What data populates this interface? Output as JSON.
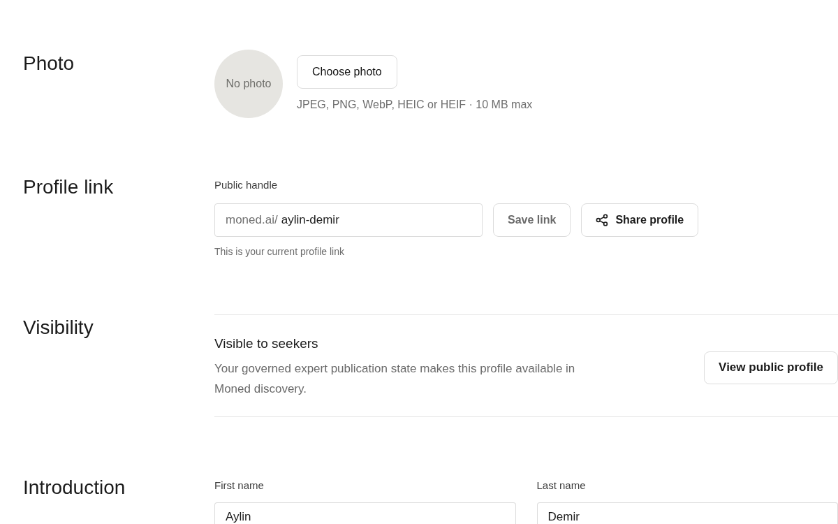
{
  "sections": [
    {
      "kind": "photo",
      "heading": "Photo",
      "avatar": {
        "text": "No photo"
      },
      "button": {
        "label": "Choose photo"
      },
      "hint": "JPEG, PNG, WebP, HEIC or HEIF · 10 MB max"
    },
    {
      "kind": "link",
      "heading": "Profile link",
      "field": {
        "label": "Public handle",
        "prefix": "moned.ai/",
        "value": "aylin-demir"
      },
      "buttons": [
        {
          "kind": "plain",
          "label": "Save link",
          "disabled": true
        },
        {
          "kind": "icon",
          "label": "Share profile",
          "disabled": false
        }
      ],
      "helper": "This is your current profile link"
    },
    {
      "kind": "visibility",
      "heading": "Visibility",
      "title": "Visible to seekers",
      "description": "Your governed expert publication state makes this profile available in Moned discovery.",
      "button": {
        "label": "View public profile"
      }
    },
    {
      "kind": "fields",
      "heading": "Introduction",
      "fields": [
        {
          "label": "First name",
          "value": "Aylin"
        },
        {
          "label": "Last name",
          "value": "Demir"
        }
      ]
    }
  ]
}
